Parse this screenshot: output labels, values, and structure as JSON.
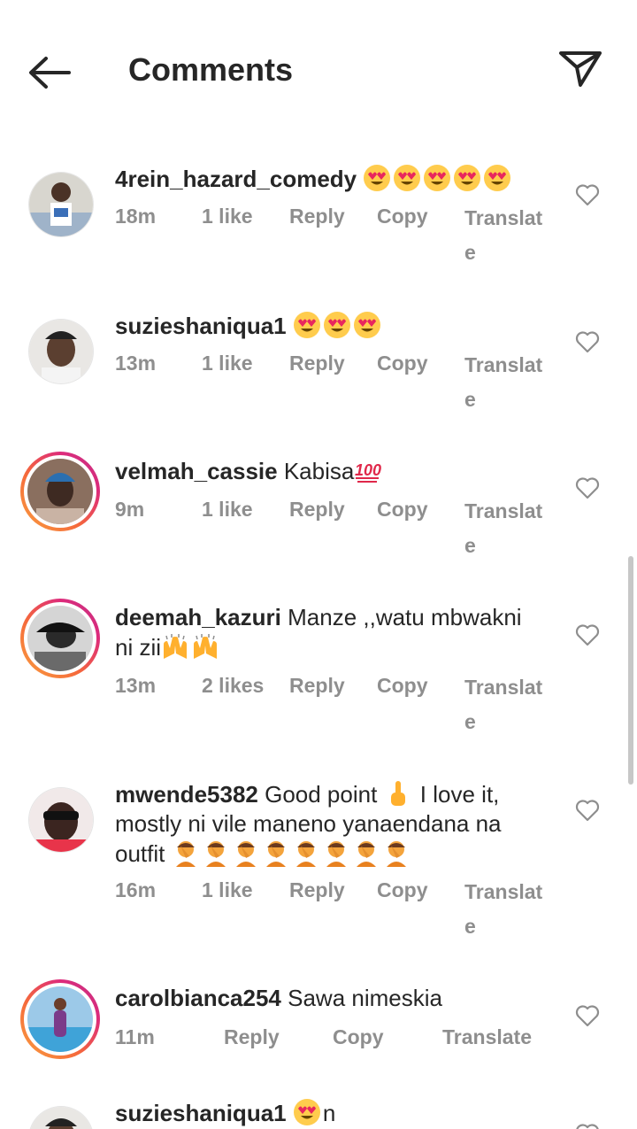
{
  "header": {
    "title": "Comments",
    "back_icon": "arrow-left-icon",
    "send_icon": "paper-plane-icon"
  },
  "colors": {
    "text": "#262626",
    "meta": "#8e8e8e",
    "story_ring_start": "#f9a03f",
    "story_ring_end": "#c13584"
  },
  "comments": [
    {
      "username": "4rein_hazard_comedy",
      "text": "",
      "emojis": [
        "heart-eyes",
        "heart-eyes",
        "heart-eyes",
        "heart-eyes",
        "heart-eyes"
      ],
      "time": "18m",
      "likes": "1 like",
      "reply": "Reply",
      "copy": "Copy",
      "translate": "Translate"
    },
    {
      "username": "suzieshaniqua1",
      "text": "",
      "emojis": [
        "heart-eyes",
        "heart-eyes",
        "heart-eyes"
      ],
      "time": "13m",
      "likes": "1 like",
      "reply": "Reply",
      "copy": "Copy",
      "translate": "Translate"
    },
    {
      "username": "velmah_cassie",
      "text": "Kabisa",
      "emojis": [
        "hundred-points"
      ],
      "time": "9m",
      "likes": "1 like",
      "reply": "Reply",
      "copy": "Copy",
      "translate": "Translate"
    },
    {
      "username": "deemah_kazuri",
      "text": "Manze ,,watu mbwakni ni zii",
      "emojis": [
        "raising-hands",
        "raising-hands"
      ],
      "time": "13m",
      "likes": "2 likes",
      "reply": "Reply",
      "copy": "Copy",
      "translate": "Translate"
    },
    {
      "username": "mwende5382",
      "text_a": "Good point",
      "text_b": "I love it, mostly ni vile  maneno yanaendana na outfit",
      "emojis": [
        "pointing-up",
        "facepalm",
        "facepalm",
        "facepalm",
        "facepalm",
        "facepalm",
        "facepalm",
        "facepalm",
        "facepalm"
      ],
      "time": "16m",
      "likes": "1 like",
      "reply": "Reply",
      "copy": "Copy",
      "translate": "Translate"
    },
    {
      "username": "carolbianca254",
      "text": "Sawa nimeskia",
      "time": "11m",
      "reply": "Reply",
      "copy": "Copy",
      "translate": "Translate"
    },
    {
      "username": "suzieshaniqua1",
      "text_after": "n",
      "emojis": [
        "heart-eyes"
      ]
    }
  ]
}
